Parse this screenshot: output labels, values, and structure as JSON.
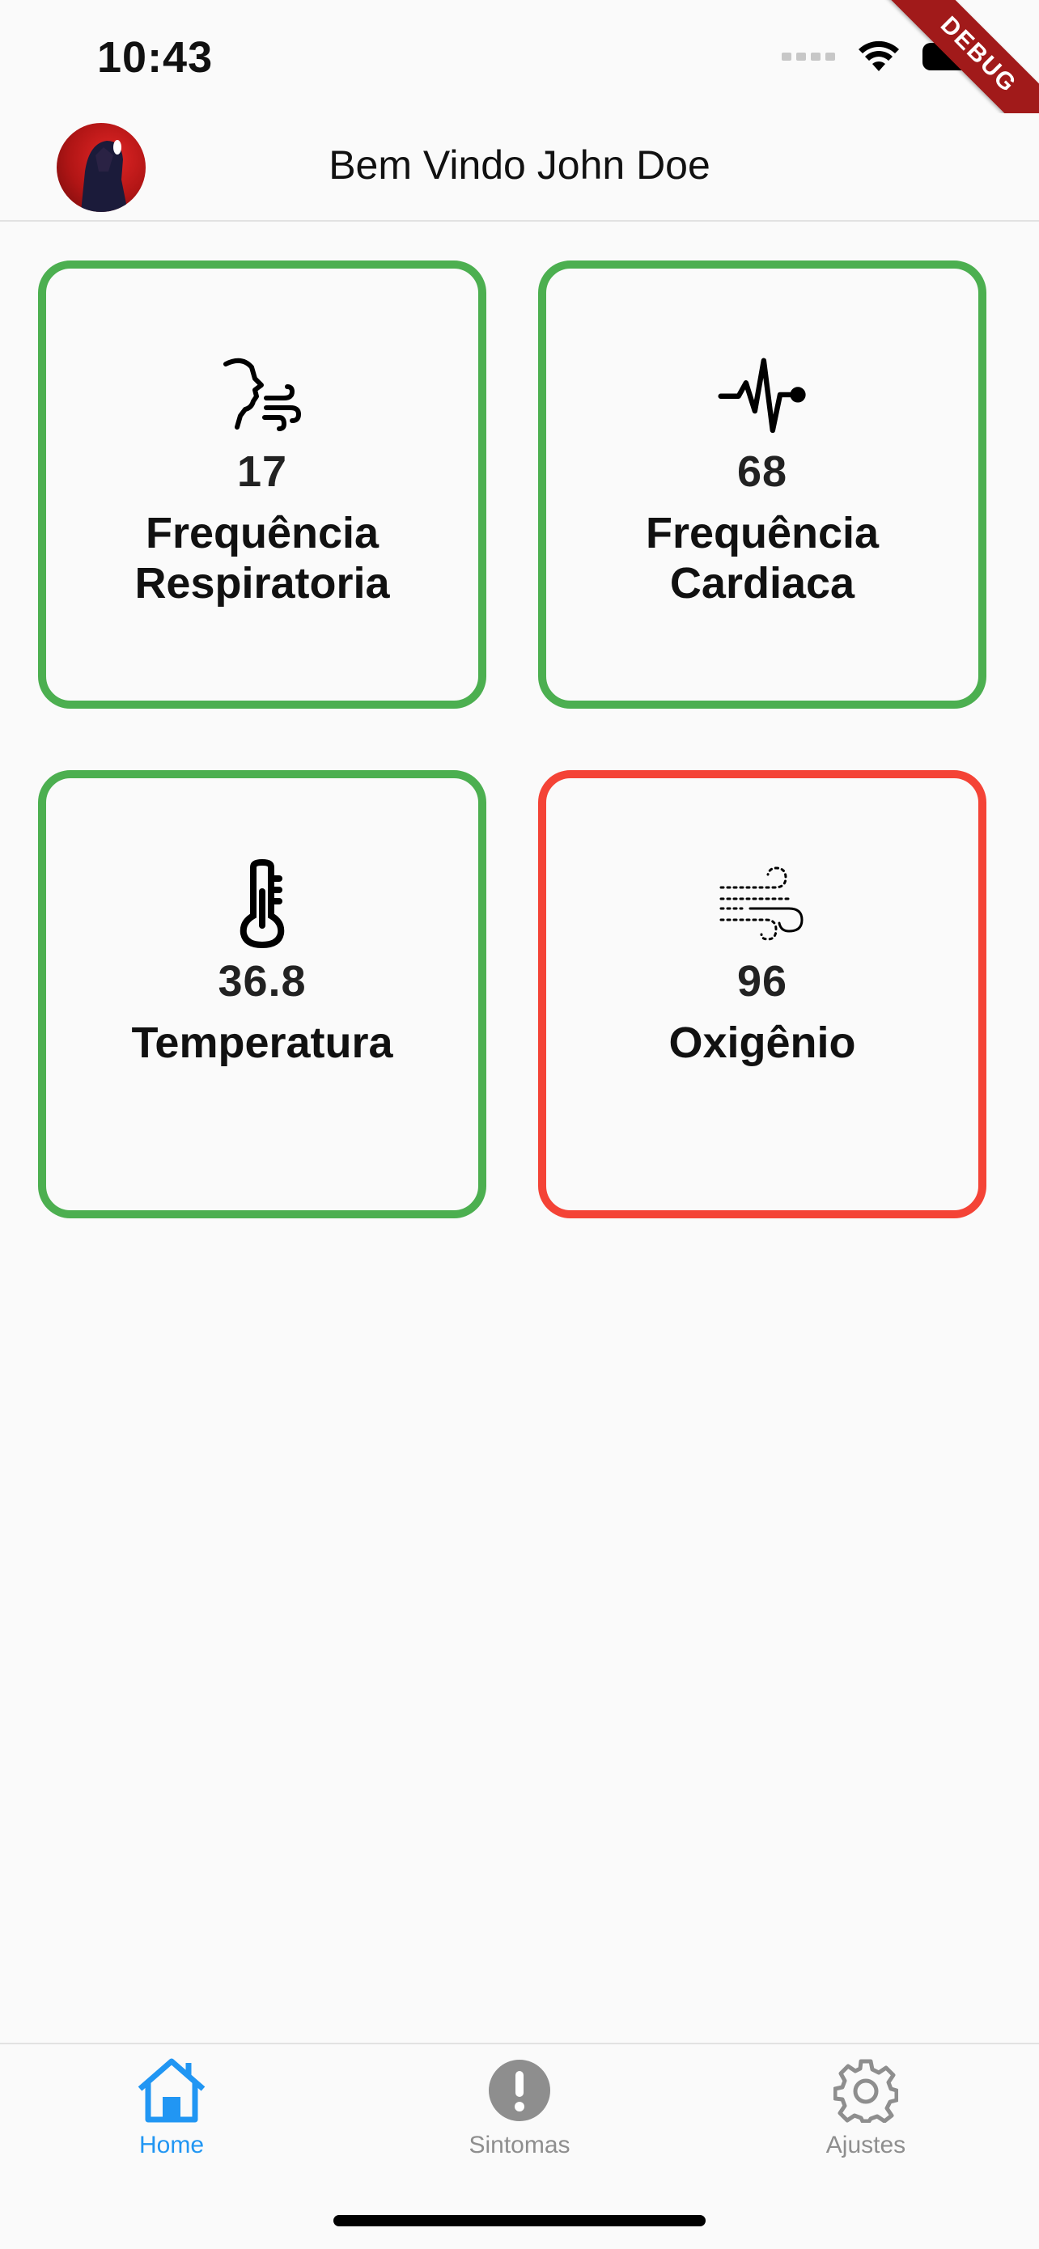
{
  "status_bar": {
    "time": "10:43"
  },
  "debug_banner": "DEBUG",
  "app_bar": {
    "title": "Bem Vindo John Doe"
  },
  "cards": [
    {
      "icon": "breathing-face-icon",
      "value": "17",
      "label_line1": "Frequência",
      "label_line2": "Respiratoria",
      "status_color": "#4caf50"
    },
    {
      "icon": "heartbeat-pulse-icon",
      "value": "68",
      "label_line1": "Frequência",
      "label_line2": "Cardiaca",
      "status_color": "#4caf50"
    },
    {
      "icon": "thermometer-icon",
      "value": "36.8",
      "label_line1": "Temperatura",
      "label_line2": "",
      "status_color": "#4caf50"
    },
    {
      "icon": "wind-icon",
      "value": "96",
      "label_line1": "Oxigênio",
      "label_line2": "",
      "status_color": "#f44336"
    }
  ],
  "bottom_nav": {
    "items": [
      {
        "label": "Home",
        "icon": "home-icon",
        "active": true
      },
      {
        "label": "Sintomas",
        "icon": "exclamation-icon",
        "active": false
      },
      {
        "label": "Ajustes",
        "icon": "gear-icon",
        "active": false
      }
    ]
  },
  "colors": {
    "accent": "#2196f3",
    "ok": "#4caf50",
    "alert": "#f44336",
    "inactive": "#8e8e8e"
  }
}
